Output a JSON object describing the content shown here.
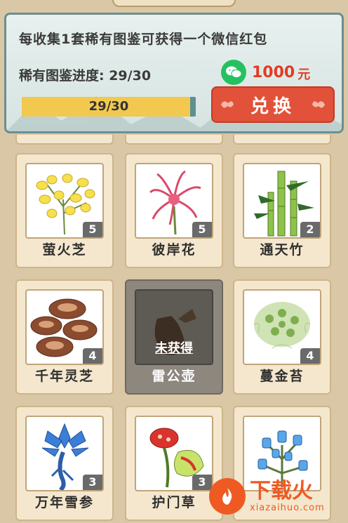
{
  "header": {
    "collect_text": "每收集1套稀有图鉴可获得一个微信红包",
    "progress_label": "稀有图鉴进度: 29/30",
    "reward_amount": "1000",
    "reward_unit": "元",
    "progress_bar_text": "29/30",
    "progress_fraction": 0.967,
    "redeem_label": "兑换"
  },
  "cards": [
    {
      "name": "萤火芝",
      "count": "5",
      "locked": false,
      "icon": "yellow-flower-icon"
    },
    {
      "name": "彼岸花",
      "count": "5",
      "locked": false,
      "icon": "red-spider-lily-icon"
    },
    {
      "name": "通天竹",
      "count": "2",
      "locked": false,
      "icon": "bamboo-icon"
    },
    {
      "name": "千年灵芝",
      "count": "4",
      "locked": false,
      "icon": "lingzhi-mushroom-icon"
    },
    {
      "name": "雷公壶",
      "locked": true,
      "locked_label": "未获得",
      "icon": "pitcher-plant-icon"
    },
    {
      "name": "蔓金苔",
      "count": "4",
      "locked": false,
      "icon": "moss-icon"
    },
    {
      "name": "万年雪参",
      "count": "3",
      "locked": false,
      "icon": "snow-ginseng-icon"
    },
    {
      "name": "护门草",
      "count": "3",
      "locked": false,
      "icon": "rafflesia-icon"
    },
    {
      "name": "",
      "locked": false,
      "icon": "blue-crystal-plant-icon"
    }
  ],
  "watermark": {
    "main": "下载火",
    "sub": "xiazaihuo.com"
  },
  "colors": {
    "accent_red": "#e2523a",
    "wechat_green": "#25c160",
    "panel_border": "#6c8e91"
  }
}
